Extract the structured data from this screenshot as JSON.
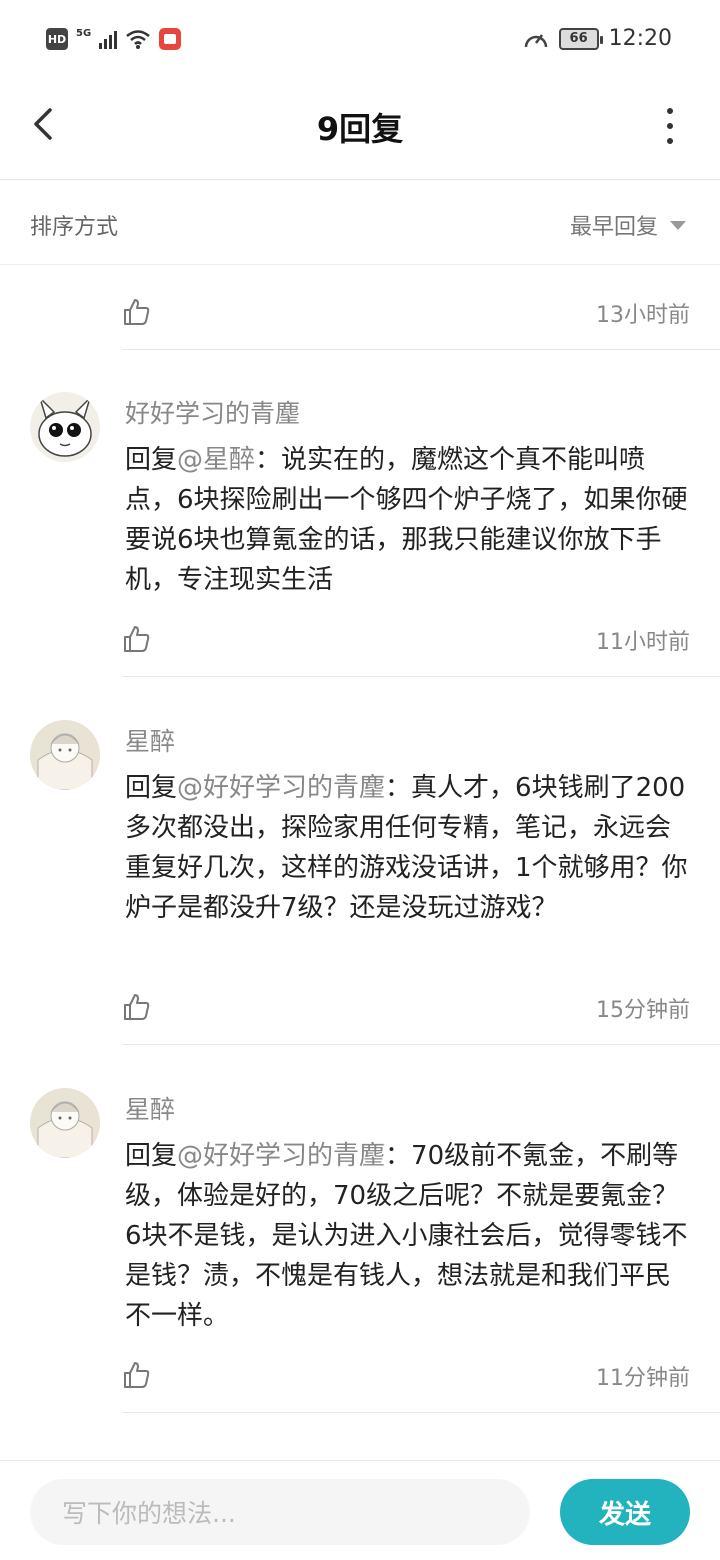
{
  "status_bar": {
    "hd": "HD",
    "network": "5G",
    "battery": "66",
    "time": "12:20"
  },
  "header": {
    "title": "9回复"
  },
  "sort": {
    "label": "排序方式",
    "value": "最早回复"
  },
  "top_item": {
    "partial_text": "",
    "time": "13小时前"
  },
  "comments": [
    {
      "username": "好好学习的青麈",
      "reply_prefix": "回复",
      "mention": "@星醉",
      "text": "：说实在的，魔燃这个真不能叫喷点，6块探险刷出一个够四个炉子烧了，如果你硬要说6块也算氪金的话，那我只能建议你放下手机，专注现实生活",
      "time": "11小时前"
    },
    {
      "username": "星醉",
      "reply_prefix": "回复",
      "mention": "@好好学习的青麈",
      "text": "：真人才，6块钱刷了200多次都没出，探险家用任何专精，笔记，永远会重复好几次，这样的游戏没话讲，1个就够用？你炉子是都没升7级？还是没玩过游戏？",
      "time": "15分钟前"
    },
    {
      "username": "星醉",
      "reply_prefix": "回复",
      "mention": "@好好学习的青麈",
      "text": "：70级前不氪金，不刷等级，体验是好的，70级之后呢？不就是要氪金？6块不是钱，是认为进入小康社会后，觉得零钱不是钱？渍，不愧是有钱人，想法就是和我们平民不一样。",
      "time": "11分钟前"
    }
  ],
  "input": {
    "placeholder": "写下你的想法...",
    "send_label": "发送"
  },
  "colors": {
    "accent": "#23b3be",
    "muted_text": "#888888"
  }
}
